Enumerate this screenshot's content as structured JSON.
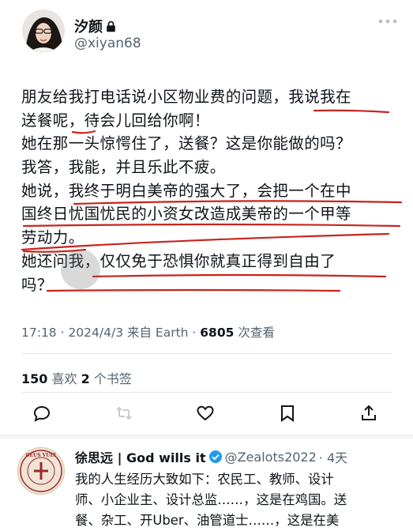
{
  "author": {
    "display_name": "汐颜",
    "handle": "@xiyan68",
    "icons": {
      "lock": "lock-icon",
      "more": "more-horizontal-icon"
    }
  },
  "tweet": {
    "lines": [
      "朋友给我打电话说小区物业费的问题，我说我在",
      "送餐呢，待会儿回给你啊！",
      "她在那一头惊愕住了，送餐？这是你能做的吗？",
      "我答，我能，并且乐此不疲。",
      "她说，我终于明白美帝的强大了，会把一个在中",
      "国终日忧国忧民的小资女改造成美帝的一个甲等",
      "劳动力。",
      "她还问我，仅仅免于恐惧你就真正得到自由了",
      "吗？"
    ],
    "meta": {
      "time_prefix": "17:18 · 2024/4/3 来自 Earth · ",
      "views_count": "6805",
      "views_label": " 次查看"
    },
    "stats": {
      "likes_count": "150",
      "likes_label": " 喜欢  ",
      "bookmarks_count": "2",
      "bookmarks_label": " 个书签"
    },
    "actions": [
      "reply-icon",
      "retweet-icon",
      "like-icon",
      "bookmark-icon",
      "share-icon"
    ],
    "colors": {
      "underline": "#c7241f",
      "muted": "#536471",
      "text": "#0f1419",
      "verified": "#1d9bf0"
    }
  },
  "reply": {
    "display_name": "徐思远 | God wills it",
    "handle": "@Zealots2022",
    "time": "· 4天",
    "avatar_text": "DEUS VULT",
    "lines": [
      "我的人生经历大致如下：农民工、教师、设计",
      "师、小企业主、设计总监……，这是在鸡国。送",
      "餐、杂工、开Uber、油管道士……，这是在美"
    ]
  }
}
